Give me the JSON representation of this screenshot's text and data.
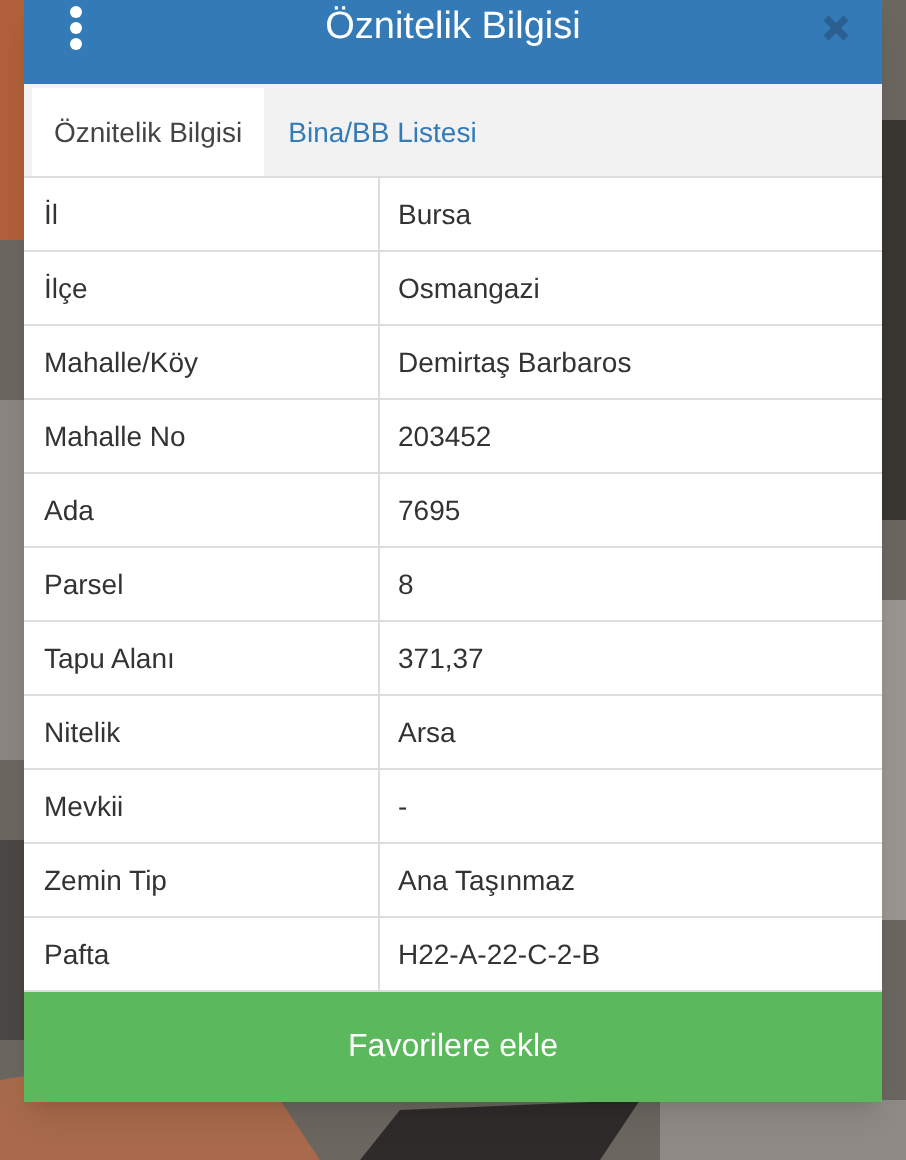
{
  "dialog": {
    "title": "Öznitelik Bilgisi"
  },
  "tabs": [
    {
      "label": "Öznitelik Bilgisi",
      "selected": true
    },
    {
      "label": "Bina/BB Listesi",
      "selected": false
    }
  ],
  "rows": [
    {
      "label": "İl",
      "value": "Bursa"
    },
    {
      "label": "İlçe",
      "value": "Osmangazi"
    },
    {
      "label": "Mahalle/Köy",
      "value": "Demirtaş Barbaros"
    },
    {
      "label": "Mahalle No",
      "value": "203452"
    },
    {
      "label": "Ada",
      "value": "7695"
    },
    {
      "label": "Parsel",
      "value": "8"
    },
    {
      "label": "Tapu Alanı",
      "value": "371,37"
    },
    {
      "label": "Nitelik",
      "value": "Arsa"
    },
    {
      "label": "Mevkii",
      "value": "-"
    },
    {
      "label": "Zemin Tip",
      "value": "Ana Taşınmaz"
    },
    {
      "label": "Pafta",
      "value": "H22-A-22-C-2-B"
    }
  ],
  "button": {
    "label": "Favorilere ekle"
  }
}
